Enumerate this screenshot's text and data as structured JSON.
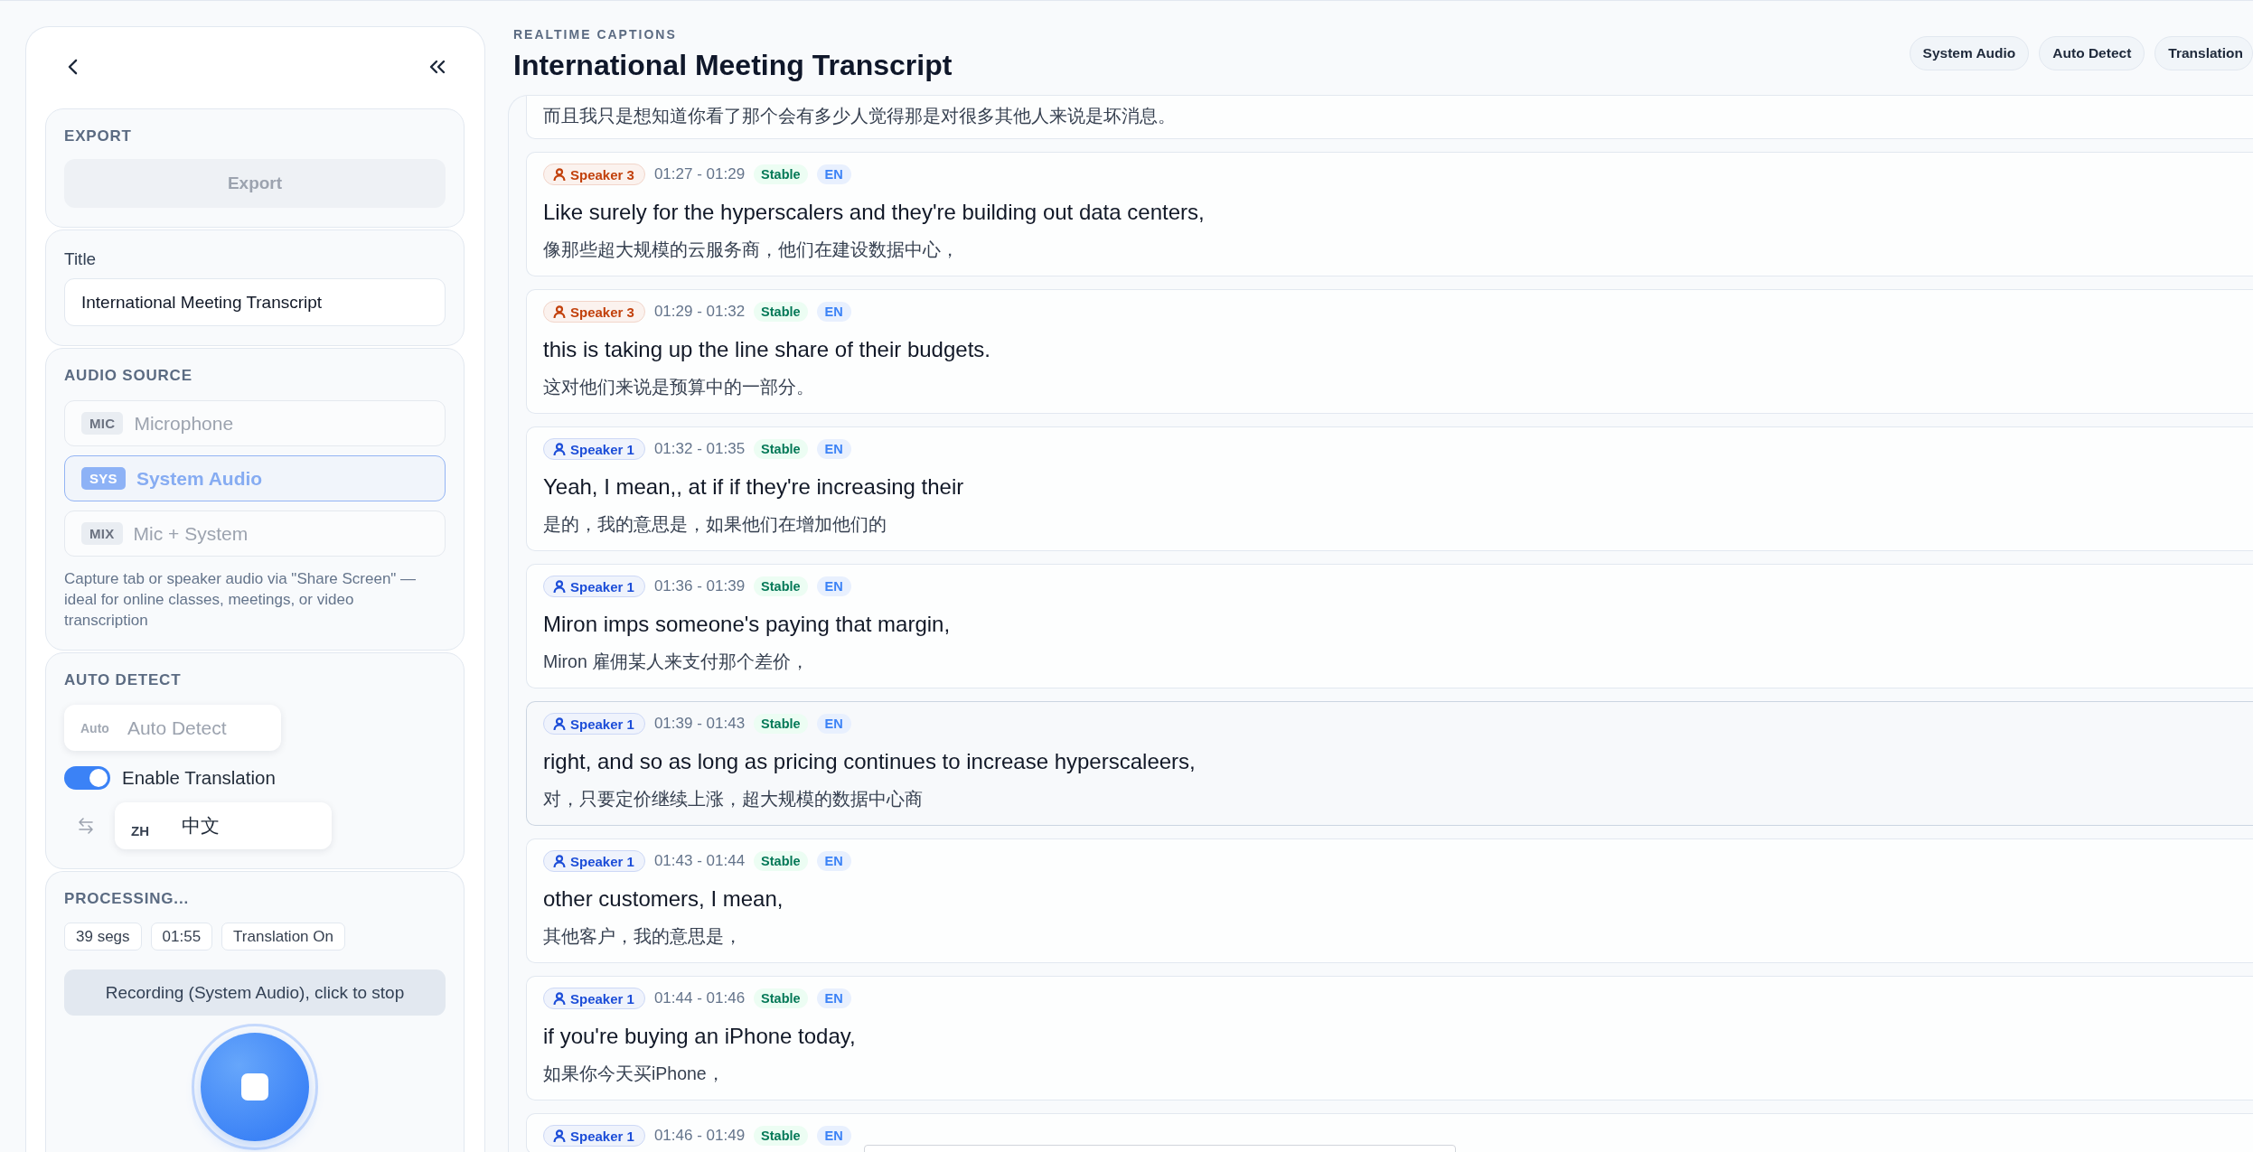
{
  "sidebar": {
    "export": {
      "heading": "EXPORT",
      "button": {
        "label": "Export",
        "disabled": true
      }
    },
    "title_field": {
      "label": "Title",
      "value": "International Meeting Transcript"
    },
    "audio_source": {
      "heading": "AUDIO SOURCE",
      "options": [
        {
          "code": "MIC",
          "label": "Microphone",
          "selected": false
        },
        {
          "code": "SYS",
          "label": "System Audio",
          "selected": true
        },
        {
          "code": "MIX",
          "label": "Mic + System",
          "selected": false
        }
      ],
      "description": "Capture tab or speaker audio via \"Share Screen\" — ideal for online classes, meetings, or video transcription"
    },
    "language": {
      "heading": "AUTO DETECT",
      "source": {
        "code": "Auto",
        "label": "Auto Detect"
      },
      "translation_toggle": {
        "label": "Enable Translation",
        "on": true
      },
      "target": {
        "code": "ZH",
        "label": "中文"
      }
    },
    "processing": {
      "heading": "PROCESSING...",
      "stats": [
        "39 segs",
        "01:55",
        "Translation On"
      ],
      "status_button": {
        "label": "Recording (System Audio), click to stop"
      },
      "recording": true
    }
  },
  "header": {
    "eyebrow": "REALTIME CAPTIONS",
    "title": "International Meeting Transcript",
    "indicators": [
      "System Audio",
      "Auto Detect",
      "Translation"
    ]
  },
  "segments": [
    {
      "translation": "而且我只是想知道你看了那个会有多少人觉得那是对很多其他人来说是坏消息。",
      "selected": false
    },
    {
      "speaker": "Speaker 3",
      "color": "#c2410c",
      "time": "01:27 - 01:29",
      "status": "Stable",
      "lang": "EN",
      "text": "Like surely for the hyperscalers and they're building out data centers,",
      "translation": "像那些超大规模的云服务商，他们在建设数据中心，",
      "selected": false
    },
    {
      "speaker": "Speaker 3",
      "color": "#c2410c",
      "time": "01:29 - 01:32",
      "status": "Stable",
      "lang": "EN",
      "text": "this is taking up the line share of their budgets.",
      "translation": "这对他们来说是预算中的一部分。",
      "selected": false
    },
    {
      "speaker": "Speaker 1",
      "color": "#1d4ed8",
      "time": "01:32 - 01:35",
      "status": "Stable",
      "lang": "EN",
      "text": "Yeah, I mean,, at if if they're increasing their",
      "translation": "是的，我的意思是，如果他们在增加他们的",
      "selected": false
    },
    {
      "speaker": "Speaker 1",
      "color": "#1d4ed8",
      "time": "01:36 - 01:39",
      "status": "Stable",
      "lang": "EN",
      "text": "Miron imps someone's paying that margin,",
      "translation": "Miron 雇佣某人来支付那个差价，",
      "selected": false
    },
    {
      "speaker": "Speaker 1",
      "color": "#1d4ed8",
      "time": "01:39 - 01:43",
      "status": "Stable",
      "lang": "EN",
      "text": "right, and so as long as pricing continues to increase hyperscaleers,",
      "translation": "对，只要定价继续上涨，超大规模的数据中心商",
      "selected": true
    },
    {
      "speaker": "Speaker 1",
      "color": "#1d4ed8",
      "time": "01:43 - 01:44",
      "status": "Stable",
      "lang": "EN",
      "text": "other customers, I mean,",
      "translation": "其他客户，我的意思是，",
      "selected": false
    },
    {
      "speaker": "Speaker 1",
      "color": "#1d4ed8",
      "time": "01:44 - 01:46",
      "status": "Stable",
      "lang": "EN",
      "text": "if you're buying an iPhone today,",
      "translation": "如果你今天买iPhone，",
      "selected": false
    },
    {
      "speaker": "Speaker 1",
      "color": "#1d4ed8",
      "time": "01:46 - 01:49",
      "status": "Stable",
      "lang": "EN",
      "selected": false
    }
  ]
}
